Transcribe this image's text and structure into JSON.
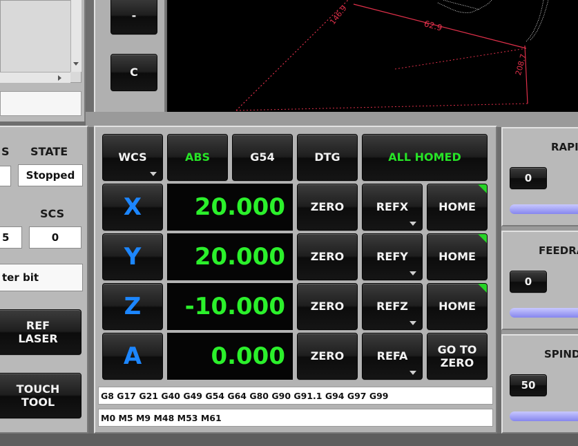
{
  "colors": {
    "accent_green": "#27e327",
    "axis_blue": "#1c86ff",
    "toolpath_red": "#e0304a",
    "slider_blue": "#8686ee"
  },
  "top_left": {
    "minus_button": "-",
    "c_button": "C"
  },
  "preview": {
    "dim1": "146.9",
    "dim2": "62.9",
    "dim3": "208.7"
  },
  "left_panel": {
    "col1_header": "S",
    "state_header": "STATE",
    "state_value": "Stopped",
    "col1b_header": "",
    "scs_header": "SCS",
    "col1b_value": "5",
    "scs_value": "0",
    "tool_text": "ter bit",
    "ref_laser_label": "REF\nLASER",
    "touch_tool_label": "TOUCH\nTOOL"
  },
  "dro_panel": {
    "header": {
      "wcs": "WCS",
      "abs": "ABS",
      "g54": "G54",
      "dtg": "DTG",
      "status": "ALL HOMED"
    },
    "axes": [
      {
        "axis": "X",
        "value": "20.000",
        "zero": "ZERO",
        "ref": "REFX",
        "home": "HOME"
      },
      {
        "axis": "Y",
        "value": "20.000",
        "zero": "ZERO",
        "ref": "REFY",
        "home": "HOME"
      },
      {
        "axis": "Z",
        "value": "-10.000",
        "zero": "ZERO",
        "ref": "REFZ",
        "home": "HOME"
      },
      {
        "axis": "A",
        "value": "0.000",
        "zero": "ZERO",
        "ref": "REFA",
        "home": "GO TO\nZERO"
      }
    ],
    "gcodes": "G8 G17 G21 G40 G49 G54 G64 G80 G90 G91.1 G94 G97 G99",
    "mcodes": "M0 M5 M9 M48 M53 M61"
  },
  "right_panel": {
    "rapid_label": "RAPI",
    "rapid_value": "0",
    "feed_label": "FEEDRA",
    "feed_value": "0",
    "spindle_label": "SPIND",
    "spindle_value": "50"
  }
}
